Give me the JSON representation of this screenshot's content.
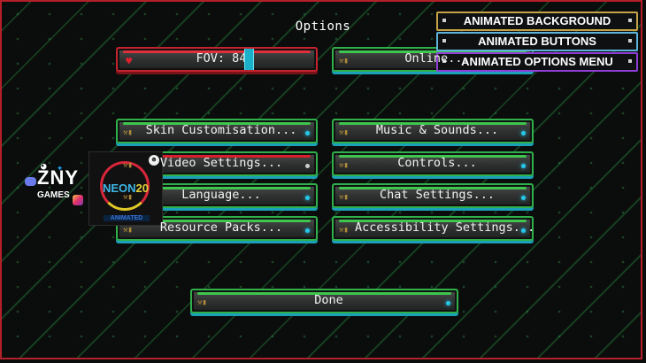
{
  "screen": {
    "title": "Options"
  },
  "fov": {
    "label": "FOV: 84"
  },
  "online_button": {
    "label": "Online..."
  },
  "buttons": {
    "skin": "Skin Customisation...",
    "music": "Music & Sounds...",
    "video": "Video Settings...",
    "controls": "Controls...",
    "language": "Language...",
    "chat": "Chat Settings...",
    "resource": "Resource Packs...",
    "accessibility": "Accessibility Settings...",
    "done": "Done"
  },
  "mod_menu": {
    "items": [
      "ANIMATED BACKGROUND",
      "ANIMATED BUTTONS",
      "ANIMATED OPTIONS MENU"
    ]
  },
  "overlay_logo": {
    "text_a": "NEON",
    "text_b": "20",
    "sub": "ANIMATED"
  },
  "brand": {
    "name": "ZNY",
    "sub": "GAMES"
  },
  "colors": {
    "accent_green": "#2fb04a",
    "accent_red": "#c4232e",
    "accent_cyan": "#1aa0b8"
  }
}
